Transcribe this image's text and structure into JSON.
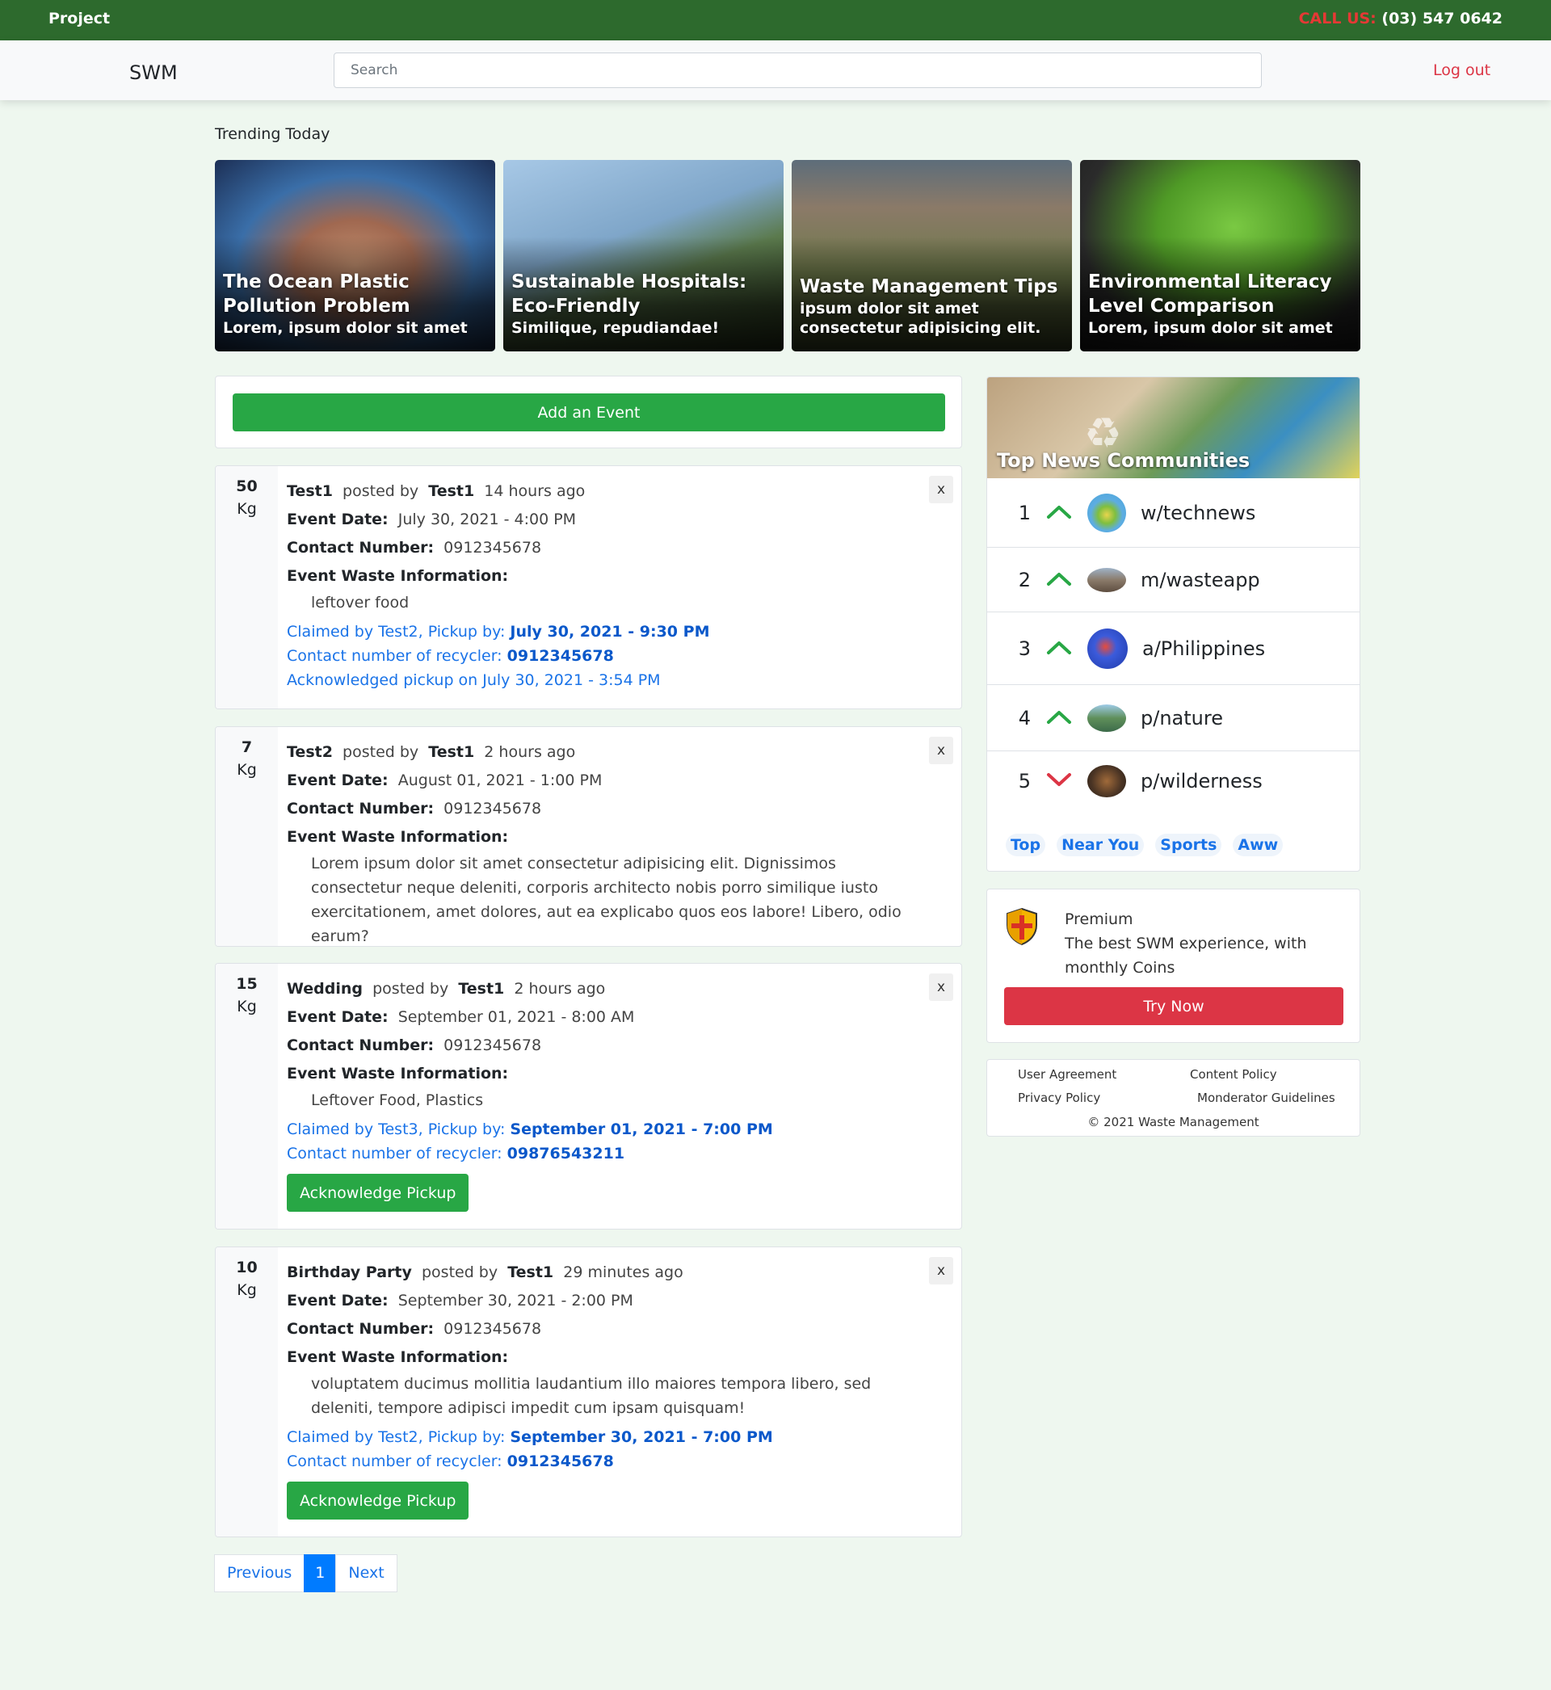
{
  "topbar": {
    "brand": "Project",
    "call_label": "CALL US:",
    "phone": "(03) 547 0642"
  },
  "navbar": {
    "logo": "SWM",
    "search_placeholder": "Search",
    "logout": "Log out"
  },
  "trending": {
    "title": "Trending Today",
    "cards": [
      {
        "title": "The Ocean Plastic Pollution Problem",
        "subtitle": "Lorem, ipsum dolor sit amet"
      },
      {
        "title": "Sustainable Hospitals: Eco-Friendly",
        "subtitle": "Similique, repudiandae!"
      },
      {
        "title": "Waste Management Tips",
        "subtitle": "ipsum dolor sit amet consectetur adipisicing elit."
      },
      {
        "title": "Environmental Literacy Level Comparison",
        "subtitle": "Lorem, ipsum dolor sit amet"
      }
    ]
  },
  "add_event": {
    "label": "Add an Event"
  },
  "labels": {
    "posted_by": "posted by",
    "event_date": "Event Date:",
    "contact_number": "Contact Number:",
    "waste_info": "Event Waste Information:",
    "contact_recycler": "Contact number of recycler:",
    "close": "x",
    "acknowledge": "Acknowledge Pickup"
  },
  "posts": [
    {
      "weight": "50",
      "unit": "Kg",
      "title": "Test1",
      "author": "Test1",
      "time": "14 hours ago",
      "event_date": "July 30, 2021 - 4:00 PM",
      "contact": "0912345678",
      "info": "leftover food",
      "claimed_prefix": "Claimed by Test2, Pickup by:",
      "pickup": "July 30, 2021 - 9:30 PM",
      "recycler": "0912345678",
      "acknowledged": "Acknowledged pickup on July 30, 2021 - 3:54 PM"
    },
    {
      "weight": "7",
      "unit": "Kg",
      "title": "Test2",
      "author": "Test1",
      "time": "2 hours ago",
      "event_date": "August 01, 2021 - 1:00 PM",
      "contact": "0912345678",
      "info": "Lorem ipsum dolor sit amet consectetur adipisicing elit. Dignissimos consectetur neque deleniti, corporis architecto nobis porro similique iusto exercitationem, amet dolores, aut ea explicabo quos eos labore! Libero, odio earum?"
    },
    {
      "weight": "15",
      "unit": "Kg",
      "title": "Wedding",
      "author": "Test1",
      "time": "2 hours ago",
      "event_date": "September 01, 2021 - 8:00 AM",
      "contact": "0912345678",
      "info": "Leftover Food, Plastics",
      "claimed_prefix": "Claimed by Test3, Pickup by:",
      "pickup": "September 01, 2021 - 7:00 PM",
      "recycler": "09876543211"
    },
    {
      "weight": "10",
      "unit": "Kg",
      "title": "Birthday Party",
      "author": "Test1",
      "time": "29 minutes ago",
      "event_date": "September 30, 2021 - 2:00 PM",
      "contact": "0912345678",
      "info": "voluptatem ducimus mollitia laudantium illo maiores tempora libero, sed deleniti, tempore adipisci impedit cum ipsam quisquam!",
      "claimed_prefix": "Claimed by Test2, Pickup by:",
      "pickup": "September 30, 2021 - 7:00 PM",
      "recycler": "0912345678"
    }
  ],
  "pagination": {
    "previous": "Previous",
    "current": "1",
    "next": "Next"
  },
  "communities": {
    "title": "Top News Communities",
    "items": [
      {
        "rank": "1",
        "trend": "up",
        "name": "w/technews"
      },
      {
        "rank": "2",
        "trend": "up",
        "name": "m/wasteapp"
      },
      {
        "rank": "3",
        "trend": "up",
        "name": "a/Philippines"
      },
      {
        "rank": "4",
        "trend": "up",
        "name": "p/nature"
      },
      {
        "rank": "5",
        "trend": "down",
        "name": "p/wilderness"
      }
    ],
    "tags": [
      "Top",
      "Near You",
      "Sports",
      "Aww"
    ]
  },
  "premium": {
    "title": "Premium",
    "description": "The best SWM experience, with monthly Coins",
    "button": "Try Now"
  },
  "footer": {
    "user_agreement": "User Agreement",
    "content_policy": "Content Policy",
    "privacy_policy": "Privacy Policy",
    "moderator_guidelines": "Monderator Guidelines",
    "copyright": "© 2021 Waste Management"
  },
  "colors": {
    "topbar": "#2d6a2d",
    "accent_green": "#28a745",
    "accent_red": "#dc3545",
    "link_blue": "#1a73e8",
    "background": "#eef7ef"
  }
}
